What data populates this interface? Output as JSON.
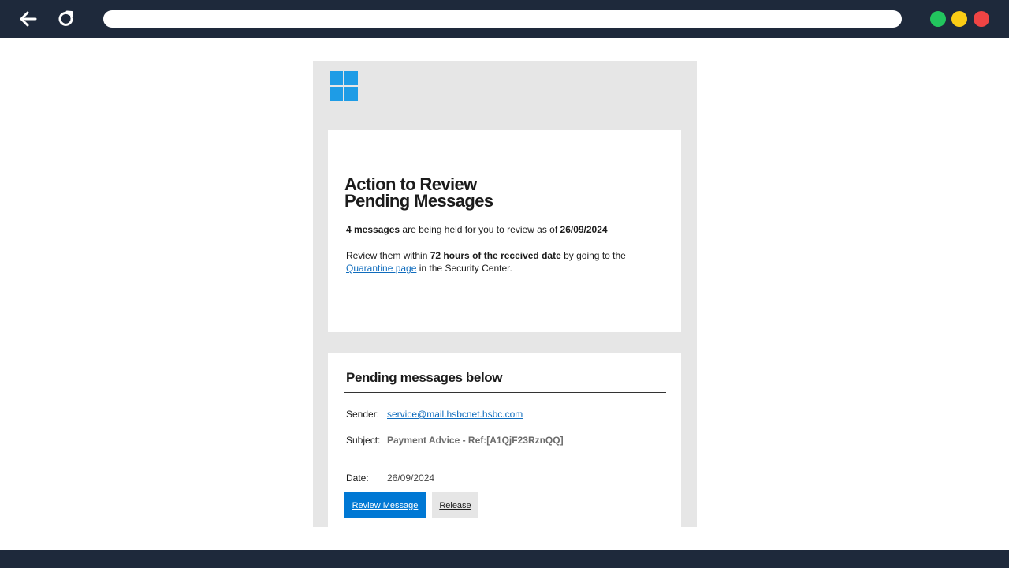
{
  "browser": {
    "back_icon": "arrow-left-icon",
    "reload_icon": "reload-icon",
    "address": "",
    "dots": [
      "#22c55e",
      "#facc15",
      "#ef4444"
    ]
  },
  "email": {
    "logo_icon": "windows-logo-icon",
    "title_line1": "Action to Review",
    "title_line2": "Pending Messages",
    "count_bold": "4 messages",
    "count_text": " are being held for you to review as of ",
    "count_date": "26/09/2024",
    "review_prefix": "Review them within ",
    "review_bold": "72 hours of the received date",
    "review_suffix": " by going to the",
    "quarantine_link": "Quarantine page",
    "security_center_text": " in the Security Center.",
    "pending_title": "Pending messages below",
    "sender_label": "Sender:",
    "sender_value": "service@mail.hsbcnet.hsbc.com",
    "subject_label": "Subject:",
    "subject_value": "Payment Advice - Ref:[A1QjF23RznQQ]",
    "date_label": "Date:",
    "date_value": "26/09/2024",
    "review_button": "Review Message",
    "release_button": "Release"
  }
}
